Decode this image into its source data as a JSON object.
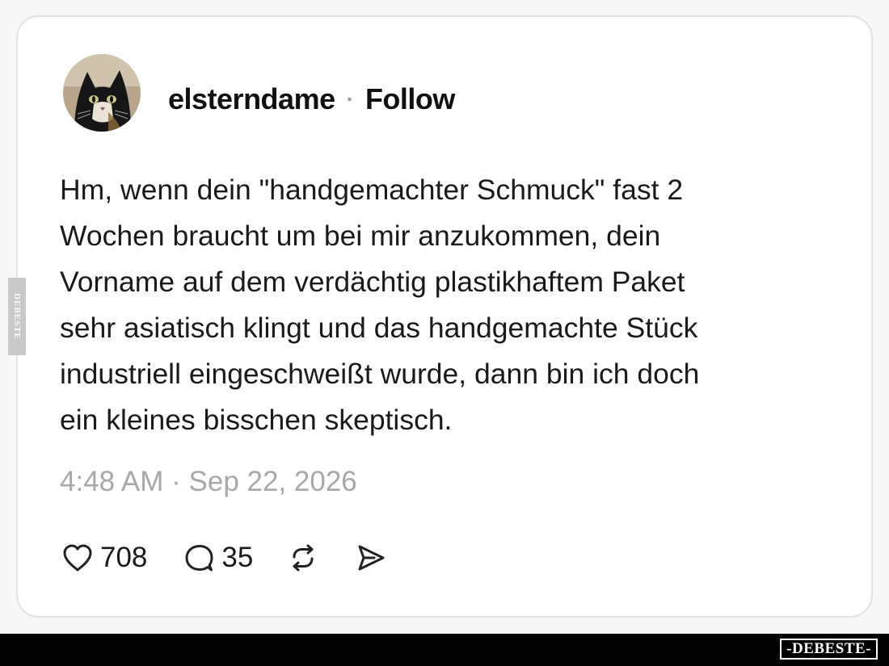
{
  "post": {
    "username": "elsterndame",
    "separator": "·",
    "follow_label": "Follow",
    "avatar_icon": "cat-avatar-icon",
    "text_lines": [
      "Hm, wenn dein \"handgemachter Schmuck\" fast 2",
      "Wochen braucht um bei mir anzukommen, dein",
      "Vorname auf dem verdächtig plastikhaftem Paket",
      "sehr asiatisch klingt und das handgemachte Stück",
      "industriell eingeschweißt wurde, dann bin ich doch",
      "ein kleines bisschen skeptisch."
    ],
    "timestamp": "4:48 AM · Sep 22, 2026",
    "likes": "708",
    "replies": "35",
    "icons": {
      "like": "heart-icon",
      "reply": "speech-bubble-icon",
      "repost": "repost-icon",
      "share": "send-icon"
    }
  },
  "watermark": {
    "footer_brand": "-DEBESTE-",
    "side_text": "DEBESTE"
  },
  "colors": {
    "background": "#f7f7f7",
    "card": "#ffffff",
    "card_border": "#e3e3e3",
    "text": "#1a1a1a",
    "muted": "#a8a8a8",
    "footer": "#000000"
  }
}
